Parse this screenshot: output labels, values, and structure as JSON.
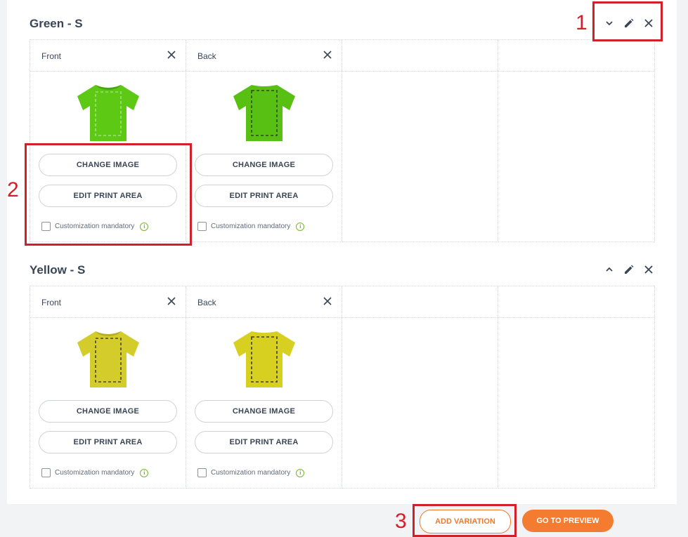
{
  "colors": {
    "accent": "#f47c30",
    "callout": "#d2202a",
    "info": "#79b52e"
  },
  "sections": [
    {
      "title": "Green - S",
      "collapse_icon": "chevron-down-icon",
      "shirt_color": "#5dc915",
      "shirt_shade": "#48a80f",
      "slots": [
        {
          "label": "Front",
          "change_label": "CHANGE IMAGE",
          "edit_label": "EDIT PRINT AREA",
          "mandatory_label": "Customization mandatory"
        },
        {
          "label": "Back",
          "change_label": "CHANGE IMAGE",
          "edit_label": "EDIT PRINT AREA",
          "mandatory_label": "Customization mandatory"
        }
      ]
    },
    {
      "title": "Yellow - S",
      "collapse_icon": "chevron-up-icon",
      "shirt_color": "#d4cc2a",
      "shirt_shade": "#b8b022",
      "slots": [
        {
          "label": "Front",
          "change_label": "CHANGE IMAGE",
          "edit_label": "EDIT PRINT AREA",
          "mandatory_label": "Customization mandatory"
        },
        {
          "label": "Back",
          "change_label": "CHANGE IMAGE",
          "edit_label": "EDIT PRINT AREA",
          "mandatory_label": "Customization mandatory"
        }
      ]
    }
  ],
  "footer": {
    "add_variation": "ADD VARIATION",
    "go_to_preview": "GO TO PREVIEW"
  },
  "callouts": {
    "one": "1",
    "two": "2",
    "three": "3"
  }
}
